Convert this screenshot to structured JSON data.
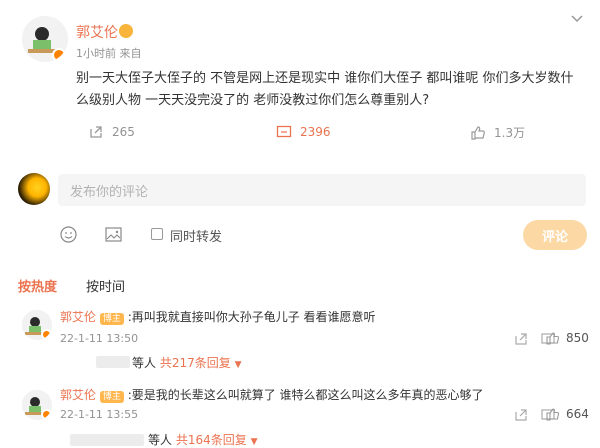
{
  "post": {
    "author": "郭艾伦",
    "meta_time": "1小时前",
    "meta_source": "来自",
    "text_line1": "别一天大侄子大侄子的 不管是网上还是现实中 谁你们大侄子 都叫谁呢 你们多大岁数什",
    "text_line2": "么级别人物 一天天没完没了的 老师没教过你们怎么尊重别人?",
    "repost_count": "265",
    "comment_count": "2396",
    "like_count": "1.3万"
  },
  "composer": {
    "placeholder": "发布你的评论",
    "also_repost": "同时转发",
    "submit_label": "评论"
  },
  "sort_tabs": {
    "hot": "按热度",
    "time": "按时间"
  },
  "comments": [
    {
      "author": "郭艾伦",
      "badge": "博主",
      "text": ":再叫我就直接叫你大孙子龟儿子 看看谁愿意听",
      "time": "22-1-11 13:50",
      "likes": "850",
      "replies_prefix": "等人",
      "replies_link": "共217条回复"
    },
    {
      "author": "郭艾伦",
      "badge": "博主",
      "text": ":要是我的长辈这么叫就算了 谁特么都这么叫这么多年真的恶心够了",
      "time": "22-1-11 13:55",
      "likes": "664",
      "replies_prefix": "等人",
      "replies_link": "共164条回复"
    }
  ],
  "colors": {
    "accent": "#eb7350",
    "button": "#fcd8a4",
    "muted": "#939393"
  }
}
